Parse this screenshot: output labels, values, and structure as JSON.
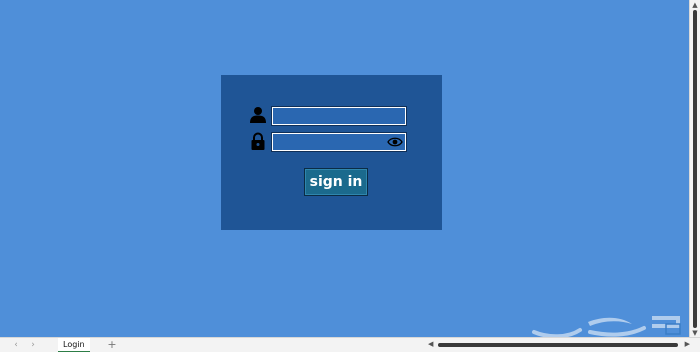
{
  "login": {
    "username_value": "",
    "password_value": "",
    "signin_label": "sign in"
  },
  "icons": {
    "user": "user-icon",
    "lock": "lock-icon",
    "eye": "eye-icon"
  },
  "sheets": {
    "tabs": [
      {
        "label": "Login",
        "active": true
      }
    ],
    "add_label": "+"
  },
  "colors": {
    "background": "#4f8fd9",
    "panel": "#1f5596",
    "button": "#1b6a8d"
  }
}
